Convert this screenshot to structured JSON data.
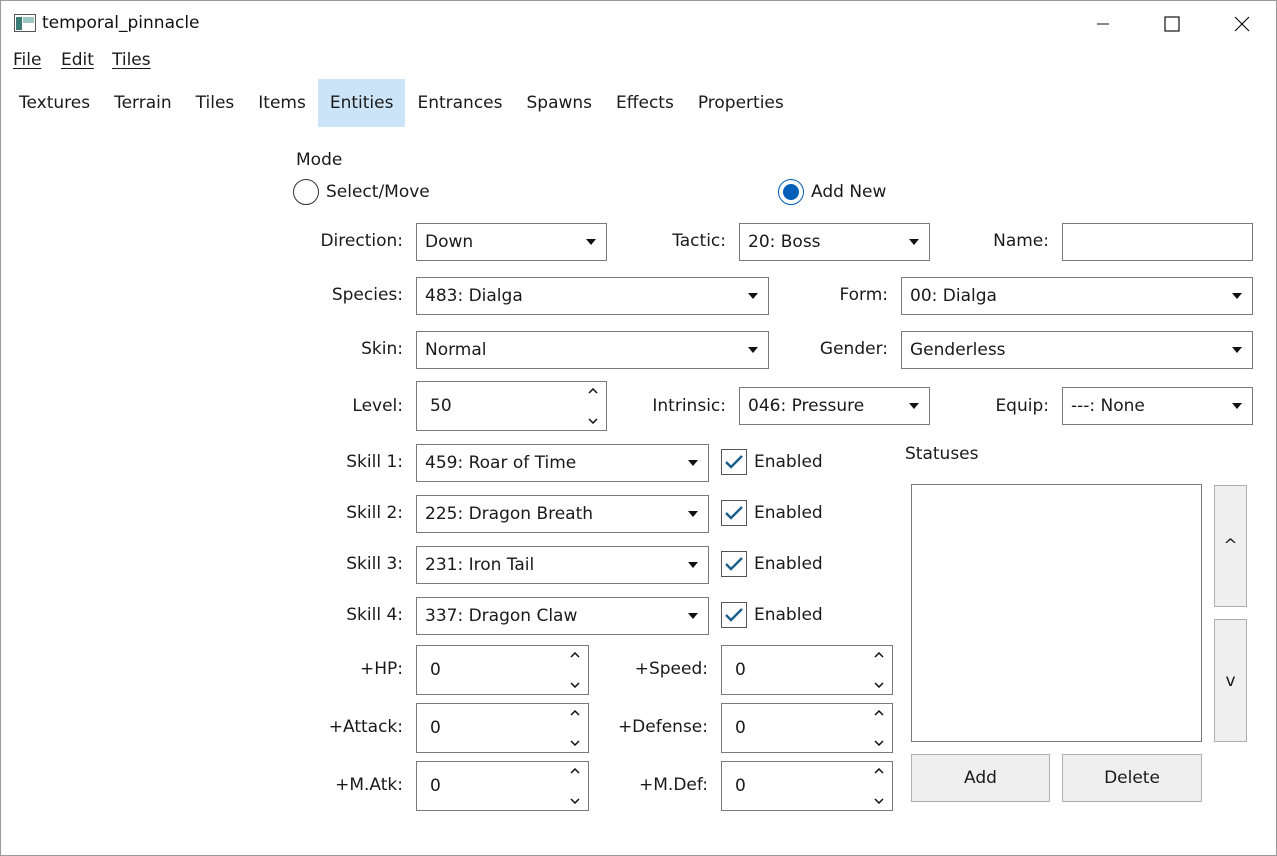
{
  "window": {
    "title": "temporal_pinnacle"
  },
  "menu": [
    "File",
    "Edit",
    "Tiles"
  ],
  "tabs": [
    "Textures",
    "Terrain",
    "Tiles",
    "Items",
    "Entities",
    "Entrances",
    "Spawns",
    "Effects",
    "Properties"
  ],
  "active_tab": "Entities",
  "mode": {
    "label": "Mode",
    "options": [
      "Select/Move",
      "Add New"
    ],
    "selected": "Add New"
  },
  "fields": {
    "direction": {
      "label": "Direction:",
      "value": "Down"
    },
    "tactic": {
      "label": "Tactic:",
      "value": "20: Boss"
    },
    "name": {
      "label": "Name:",
      "value": ""
    },
    "species": {
      "label": "Species:",
      "value": "483: Dialga"
    },
    "form": {
      "label": "Form:",
      "value": "00: Dialga"
    },
    "skin": {
      "label": "Skin:",
      "value": "Normal"
    },
    "gender": {
      "label": "Gender:",
      "value": "Genderless"
    },
    "level": {
      "label": "Level:",
      "value": "50"
    },
    "intrinsic": {
      "label": "Intrinsic:",
      "value": "046: Pressure"
    },
    "equip": {
      "label": "Equip:",
      "value": "---: None"
    }
  },
  "skills": [
    {
      "label": "Skill 1:",
      "value": "459: Roar of Time",
      "enabled_label": "Enabled",
      "enabled": true
    },
    {
      "label": "Skill 2:",
      "value": "225: Dragon Breath",
      "enabled_label": "Enabled",
      "enabled": true
    },
    {
      "label": "Skill 3:",
      "value": "231: Iron Tail",
      "enabled_label": "Enabled",
      "enabled": true
    },
    {
      "label": "Skill 4:",
      "value": "337: Dragon Claw",
      "enabled_label": "Enabled",
      "enabled": true
    }
  ],
  "stats": {
    "hp": {
      "label": "+HP:",
      "value": "0"
    },
    "speed": {
      "label": "+Speed:",
      "value": "0"
    },
    "attack": {
      "label": "+Attack:",
      "value": "0"
    },
    "defense": {
      "label": "+Defense:",
      "value": "0"
    },
    "matk": {
      "label": "+M.Atk:",
      "value": "0"
    },
    "mdef": {
      "label": "+M.Def:",
      "value": "0"
    }
  },
  "statuses": {
    "label": "Statuses",
    "items": [],
    "up_label": "^",
    "down_label": "v",
    "add_label": "Add",
    "delete_label": "Delete"
  },
  "colors": {
    "accent": "#005fb8",
    "tab_active": "#cce4f7",
    "check": "#1b5e8c"
  }
}
